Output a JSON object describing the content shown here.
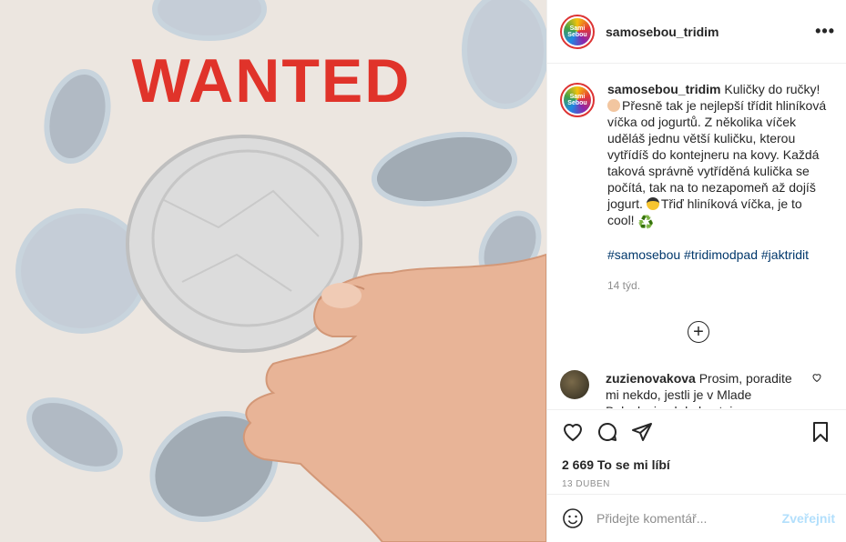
{
  "post": {
    "username": "samosebou_tridim",
    "avatar_text": "Sami Sebou",
    "more_icon": "•••",
    "image_headline": "WANTED",
    "caption_parts": [
      "Kuličky do ručky!",
      "Přesně tak je nejlepší třídit hliníková víčka od jogurtů. Z několika víček uděláš jednu větší kuličku, kterou vytřídíš do kontejneru na kovy. Každá taková správně vytříděná kulička se počítá, tak na to nezapomeň až dojíš jogurt.",
      "Třiď hliníková víčka, je to cool!",
      "♻️"
    ],
    "hashtags": "#samosebou #tridimodpad #jaktridit",
    "time_ago": "14 týd.",
    "load_more_icon": "+",
    "comment": {
      "username": "zuzienovakova",
      "text": "Prosim, poradite mi nekdo, jestli je v Mlade Boleslavi nekde kontejner na"
    },
    "likes": "2 669 To se mi líbí",
    "date": "13 DUBEN",
    "add_comment_placeholder": "Přidejte komentář...",
    "post_button": "Zveřejnit",
    "icons": [
      "heart-icon",
      "comment-icon",
      "share-icon",
      "bookmark-icon",
      "emoji-icon",
      "small-heart-icon",
      "more-options-icon",
      "load-more-icon"
    ],
    "colors": {
      "headline_red": "#e0332a",
      "hashtag_blue": "#00376b",
      "post_button_disabled": "#b2dffc"
    }
  }
}
